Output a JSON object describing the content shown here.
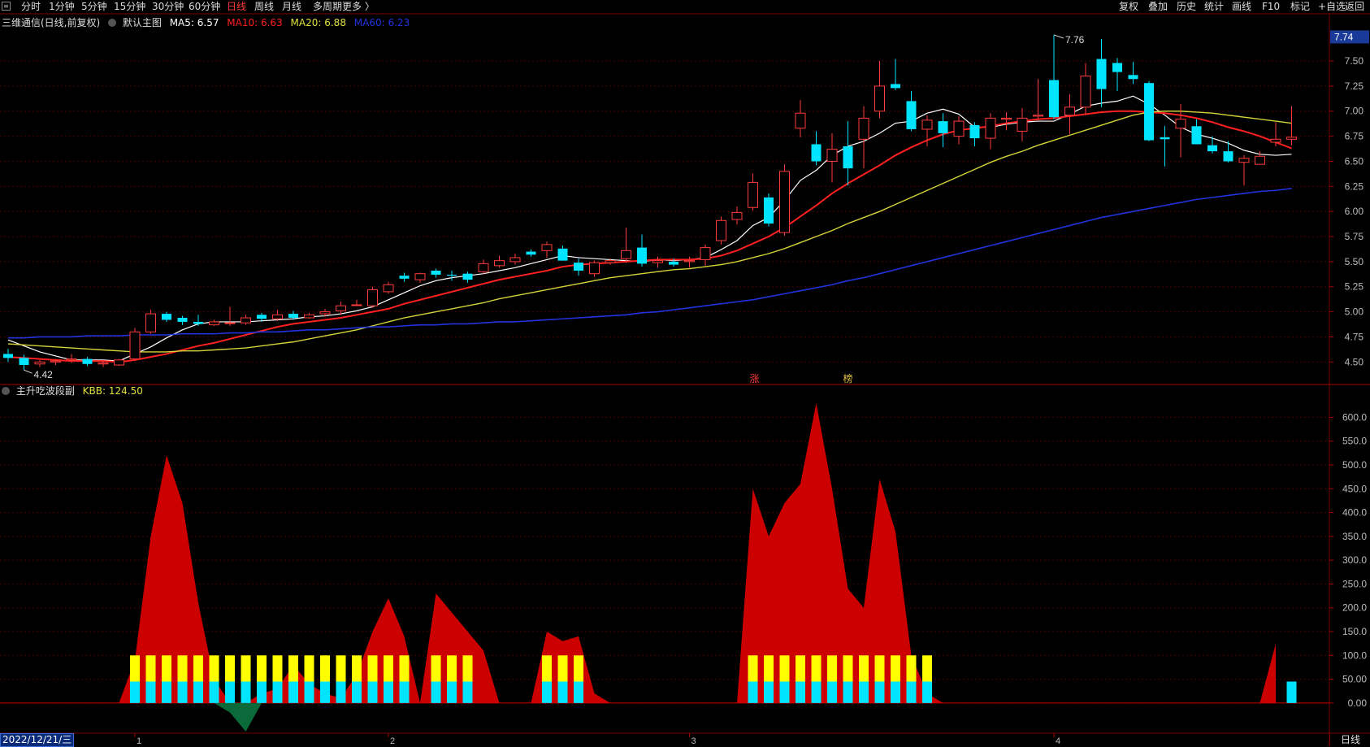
{
  "toolbar": {
    "tabs": [
      {
        "label": "分时",
        "active": false
      },
      {
        "label": "1分钟",
        "active": false
      },
      {
        "label": "5分钟",
        "active": false
      },
      {
        "label": "15分钟",
        "active": false
      },
      {
        "label": "30分钟",
        "active": false
      },
      {
        "label": "60分钟",
        "active": false
      },
      {
        "label": "日线",
        "active": true
      },
      {
        "label": "周线",
        "active": false
      },
      {
        "label": "月线",
        "active": false
      },
      {
        "label": "多周期",
        "active": false
      },
      {
        "label": "更多 〉",
        "active": false
      }
    ],
    "right_actions": [
      "复权",
      "叠加",
      "历史",
      "统计",
      "画线",
      "F10",
      "标记",
      "+自选",
      "返回"
    ]
  },
  "main_legend": {
    "title": "三维通信(日线,前复权)",
    "template": "默认主图",
    "ma5": "MA5: 6.57",
    "ma10": "MA10: 6.63",
    "ma20": "MA20: 6.88",
    "ma60": "MA60: 6.23"
  },
  "sub_legend": {
    "title": "主升吃波段副",
    "kbb": "KBB: 124.50"
  },
  "markers": {
    "zhang": "涨",
    "bang": "榜"
  },
  "bottom": {
    "date": "2022/12/21/三",
    "period": "日线",
    "month_marks": [
      "1",
      "2",
      "3",
      "4"
    ]
  },
  "colors": {
    "up": "#ff3b3b",
    "down": "#00e5ff",
    "ma5": "#ffffff",
    "ma10": "#ff2020",
    "ma20": "#d4d43a",
    "ma60": "#2233dd",
    "bg": "#000000",
    "area": "#cc0000",
    "bar_top": "#ffff00",
    "bar_bottom": "#00e5ff"
  },
  "chart_data": [
    {
      "type": "candlestick",
      "title": "三维通信(日线,前复权)",
      "ylim": [
        4.3,
        7.8
      ],
      "y_ticks": [
        "4.50",
        "4.75",
        "5.00",
        "5.25",
        "5.50",
        "5.75",
        "6.00",
        "6.25",
        "6.50",
        "6.75",
        "7.00",
        "7.25",
        "7.50"
      ],
      "current_price_label": "7.74",
      "high_label": "7.76",
      "low_label": "4.42",
      "ohlc": [
        [
          4.58,
          4.63,
          4.5,
          4.54
        ],
        [
          4.54,
          4.57,
          4.42,
          4.47
        ],
        [
          4.48,
          4.52,
          4.45,
          4.5
        ],
        [
          4.5,
          4.53,
          4.47,
          4.51
        ],
        [
          4.52,
          4.58,
          4.49,
          4.53
        ],
        [
          4.53,
          4.55,
          4.46,
          4.48
        ],
        [
          4.48,
          4.52,
          4.45,
          4.49
        ],
        [
          4.47,
          4.53,
          4.46,
          4.52
        ],
        [
          4.53,
          4.84,
          4.52,
          4.8
        ],
        [
          4.8,
          5.02,
          4.78,
          4.98
        ],
        [
          4.98,
          5.0,
          4.9,
          4.92
        ],
        [
          4.94,
          4.96,
          4.87,
          4.9
        ],
        [
          4.9,
          4.97,
          4.86,
          4.88
        ],
        [
          4.87,
          4.92,
          4.86,
          4.9
        ],
        [
          4.89,
          5.05,
          4.86,
          4.89
        ],
        [
          4.89,
          4.97,
          4.87,
          4.94
        ],
        [
          4.97,
          4.99,
          4.9,
          4.93
        ],
        [
          4.93,
          5.02,
          4.91,
          4.97
        ],
        [
          4.98,
          5.01,
          4.92,
          4.94
        ],
        [
          4.94,
          4.99,
          4.93,
          4.97
        ],
        [
          4.98,
          5.03,
          4.95,
          5.0
        ],
        [
          5.01,
          5.1,
          4.97,
          5.06
        ],
        [
          5.07,
          5.12,
          5.06,
          5.07
        ],
        [
          5.06,
          5.25,
          5.04,
          5.22
        ],
        [
          5.2,
          5.3,
          5.18,
          5.27
        ],
        [
          5.36,
          5.39,
          5.3,
          5.33
        ],
        [
          5.32,
          5.39,
          5.29,
          5.38
        ],
        [
          5.41,
          5.43,
          5.34,
          5.37
        ],
        [
          5.37,
          5.41,
          5.31,
          5.36
        ],
        [
          5.38,
          5.4,
          5.29,
          5.32
        ],
        [
          5.4,
          5.52,
          5.38,
          5.48
        ],
        [
          5.46,
          5.56,
          5.44,
          5.51
        ],
        [
          5.5,
          5.58,
          5.47,
          5.54
        ],
        [
          5.6,
          5.62,
          5.55,
          5.57
        ],
        [
          5.61,
          5.7,
          5.54,
          5.67
        ],
        [
          5.63,
          5.66,
          5.51,
          5.51
        ],
        [
          5.49,
          5.53,
          5.36,
          5.41
        ],
        [
          5.38,
          5.51,
          5.35,
          5.49
        ],
        [
          5.49,
          5.53,
          5.47,
          5.51
        ],
        [
          5.53,
          5.84,
          5.49,
          5.61
        ],
        [
          5.64,
          5.77,
          5.45,
          5.48
        ],
        [
          5.49,
          5.55,
          5.44,
          5.51
        ],
        [
          5.5,
          5.53,
          5.45,
          5.47
        ],
        [
          5.5,
          5.55,
          5.44,
          5.51
        ],
        [
          5.52,
          5.67,
          5.46,
          5.64
        ],
        [
          5.71,
          5.95,
          5.67,
          5.91
        ],
        [
          5.92,
          6.05,
          5.87,
          5.99
        ],
        [
          6.04,
          6.38,
          6.01,
          6.29
        ],
        [
          6.14,
          6.18,
          5.85,
          5.88
        ],
        [
          5.79,
          6.47,
          5.76,
          6.4
        ],
        [
          6.83,
          7.11,
          6.74,
          6.98
        ],
        [
          6.67,
          6.8,
          6.46,
          6.5
        ],
        [
          6.5,
          6.78,
          6.29,
          6.62
        ],
        [
          6.65,
          6.9,
          6.26,
          6.43
        ],
        [
          6.72,
          7.05,
          6.43,
          6.93
        ],
        [
          7.0,
          7.5,
          6.93,
          7.25
        ],
        [
          7.27,
          7.52,
          7.21,
          7.23
        ],
        [
          7.1,
          7.2,
          6.8,
          6.82
        ],
        [
          6.82,
          6.96,
          6.65,
          6.91
        ],
        [
          6.9,
          6.98,
          6.64,
          6.78
        ],
        [
          6.75,
          6.95,
          6.67,
          6.9
        ],
        [
          6.86,
          6.89,
          6.65,
          6.73
        ],
        [
          6.73,
          6.98,
          6.62,
          6.93
        ],
        [
          6.92,
          6.99,
          6.81,
          6.93
        ],
        [
          6.8,
          7.03,
          6.7,
          6.93
        ],
        [
          6.95,
          7.32,
          6.91,
          6.96
        ],
        [
          7.31,
          7.76,
          6.92,
          6.94
        ],
        [
          6.96,
          7.17,
          6.77,
          7.04
        ],
        [
          7.04,
          7.48,
          6.96,
          7.35
        ],
        [
          7.52,
          7.72,
          7.04,
          7.22
        ],
        [
          7.48,
          7.53,
          7.2,
          7.39
        ],
        [
          7.36,
          7.49,
          7.27,
          7.32
        ],
        [
          7.28,
          7.3,
          6.7,
          6.71
        ],
        [
          6.74,
          6.85,
          6.45,
          6.72
        ],
        [
          6.83,
          7.07,
          6.54,
          6.92
        ],
        [
          6.85,
          6.92,
          6.67,
          6.67
        ],
        [
          6.66,
          6.75,
          6.58,
          6.6
        ],
        [
          6.6,
          6.7,
          6.49,
          6.5
        ],
        [
          6.49,
          6.56,
          6.26,
          6.53
        ],
        [
          6.47,
          6.6,
          6.47,
          6.55
        ],
        [
          6.69,
          6.89,
          6.65,
          6.72
        ],
        [
          6.72,
          7.05,
          6.66,
          6.74
        ]
      ],
      "ma_series": [
        {
          "name": "MA5",
          "values": [
            4.72,
            4.66,
            4.6,
            4.56,
            4.52,
            4.52,
            4.52,
            4.51,
            4.58,
            4.65,
            4.74,
            4.82,
            4.88,
            4.9,
            4.9,
            4.9,
            4.91,
            4.92,
            4.93,
            4.95,
            4.96,
            4.98,
            5.01,
            5.05,
            5.12,
            5.19,
            5.26,
            5.31,
            5.34,
            5.36,
            5.38,
            5.41,
            5.44,
            5.48,
            5.52,
            5.56,
            5.54,
            5.53,
            5.52,
            5.51,
            5.5,
            5.52,
            5.51,
            5.52,
            5.54,
            5.62,
            5.71,
            5.86,
            5.94,
            6.11,
            6.31,
            6.41,
            6.56,
            6.65,
            6.7,
            6.78,
            6.88,
            6.9,
            6.98,
            7.02,
            6.97,
            6.84,
            6.84,
            6.87,
            6.89,
            6.9,
            6.9,
            6.97,
            7.05,
            7.08,
            7.1,
            7.15,
            7.07,
            6.96,
            6.84,
            6.77,
            6.73,
            6.68,
            6.61,
            6.57,
            6.56,
            6.57
          ]
        },
        {
          "name": "MA10",
          "values": [
            4.55,
            4.54,
            4.53,
            4.52,
            4.51,
            4.51,
            4.51,
            4.5,
            4.52,
            4.55,
            4.58,
            4.62,
            4.66,
            4.69,
            4.73,
            4.77,
            4.81,
            4.85,
            4.88,
            4.9,
            4.92,
            4.94,
            4.97,
            5.0,
            5.03,
            5.08,
            5.12,
            5.16,
            5.2,
            5.24,
            5.28,
            5.32,
            5.35,
            5.38,
            5.41,
            5.45,
            5.47,
            5.48,
            5.49,
            5.5,
            5.51,
            5.52,
            5.52,
            5.52,
            5.53,
            5.56,
            5.61,
            5.68,
            5.75,
            5.84,
            5.95,
            6.06,
            6.18,
            6.28,
            6.37,
            6.46,
            6.56,
            6.64,
            6.71,
            6.77,
            6.81,
            6.83,
            6.85,
            6.88,
            6.9,
            6.92,
            6.93,
            6.95,
            6.97,
            6.99,
            7.0,
            7.0,
            6.99,
            6.98,
            6.96,
            6.93,
            6.89,
            6.84,
            6.8,
            6.75,
            6.69,
            6.63
          ]
        },
        {
          "name": "MA20",
          "values": [
            4.68,
            4.67,
            4.66,
            4.65,
            4.64,
            4.63,
            4.62,
            4.61,
            4.6,
            4.6,
            4.6,
            4.61,
            4.61,
            4.62,
            4.63,
            4.64,
            4.66,
            4.68,
            4.7,
            4.73,
            4.76,
            4.79,
            4.82,
            4.86,
            4.9,
            4.94,
            4.97,
            5.0,
            5.03,
            5.06,
            5.09,
            5.13,
            5.16,
            5.19,
            5.22,
            5.25,
            5.28,
            5.31,
            5.34,
            5.36,
            5.38,
            5.4,
            5.42,
            5.43,
            5.45,
            5.47,
            5.5,
            5.54,
            5.58,
            5.63,
            5.69,
            5.75,
            5.81,
            5.88,
            5.94,
            6.0,
            6.07,
            6.14,
            6.21,
            6.28,
            6.35,
            6.42,
            6.49,
            6.55,
            6.6,
            6.66,
            6.71,
            6.76,
            6.81,
            6.86,
            6.91,
            6.96,
            6.99,
            7.0,
            7.0,
            6.99,
            6.98,
            6.96,
            6.94,
            6.92,
            6.9,
            6.88
          ]
        },
        {
          "name": "MA60",
          "values": [
            4.74,
            4.74,
            4.75,
            4.75,
            4.75,
            4.76,
            4.76,
            4.76,
            4.77,
            4.77,
            4.77,
            4.78,
            4.78,
            4.78,
            4.79,
            4.79,
            4.8,
            4.8,
            4.81,
            4.82,
            4.82,
            4.83,
            4.84,
            4.85,
            4.85,
            4.86,
            4.87,
            4.87,
            4.88,
            4.88,
            4.89,
            4.9,
            4.9,
            4.91,
            4.92,
            4.93,
            4.94,
            4.95,
            4.96,
            4.97,
            4.99,
            5.0,
            5.02,
            5.04,
            5.06,
            5.08,
            5.1,
            5.12,
            5.15,
            5.18,
            5.21,
            5.24,
            5.27,
            5.31,
            5.34,
            5.38,
            5.42,
            5.46,
            5.5,
            5.54,
            5.58,
            5.62,
            5.66,
            5.7,
            5.74,
            5.78,
            5.82,
            5.86,
            5.9,
            5.94,
            5.97,
            6.0,
            6.03,
            6.06,
            6.09,
            6.12,
            6.14,
            6.16,
            6.18,
            6.2,
            6.21,
            6.23
          ]
        }
      ]
    },
    {
      "type": "area",
      "title": "主升吃波段副",
      "ylim": [
        -60,
        640
      ],
      "y_ticks": [
        "0.00",
        "50.00",
        "100.0",
        "150.0",
        "200.0",
        "250.0",
        "300.0",
        "350.0",
        "400.0",
        "450.0",
        "500.0",
        "550.0",
        "600.0"
      ],
      "values": [
        0,
        0,
        0,
        0,
        0,
        0,
        0,
        0,
        90,
        350,
        520,
        420,
        210,
        50,
        -20,
        -60,
        20,
        30,
        80,
        40,
        20,
        10,
        60,
        150,
        220,
        140,
        0,
        230,
        190,
        150,
        110,
        0,
        0,
        0,
        150,
        130,
        140,
        20,
        0,
        0,
        0,
        0,
        0,
        0,
        0,
        0,
        0,
        450,
        350,
        420,
        460,
        630,
        450,
        240,
        200,
        470,
        360,
        100,
        20,
        0,
        0,
        0,
        0,
        0,
        0,
        0,
        0,
        0,
        0,
        0,
        0,
        0,
        0,
        0,
        0,
        0,
        0,
        0,
        0,
        0,
        124.5
      ],
      "signal_bars": [
        0,
        0,
        0,
        0,
        0,
        0,
        0,
        0,
        1,
        1,
        1,
        1,
        1,
        1,
        1,
        1,
        1,
        1,
        1,
        1,
        1,
        1,
        1,
        1,
        1,
        1,
        0,
        1,
        1,
        1,
        0,
        0,
        0,
        0,
        1,
        1,
        1,
        0,
        0,
        0,
        0,
        0,
        0,
        0,
        0,
        0,
        0,
        1,
        1,
        1,
        1,
        1,
        1,
        1,
        1,
        1,
        1,
        1,
        1,
        0,
        0,
        0,
        0,
        0,
        0,
        0,
        0,
        0,
        0,
        0,
        0,
        0,
        0,
        0,
        0,
        0,
        0,
        0,
        0,
        0,
        0,
        2
      ]
    }
  ]
}
